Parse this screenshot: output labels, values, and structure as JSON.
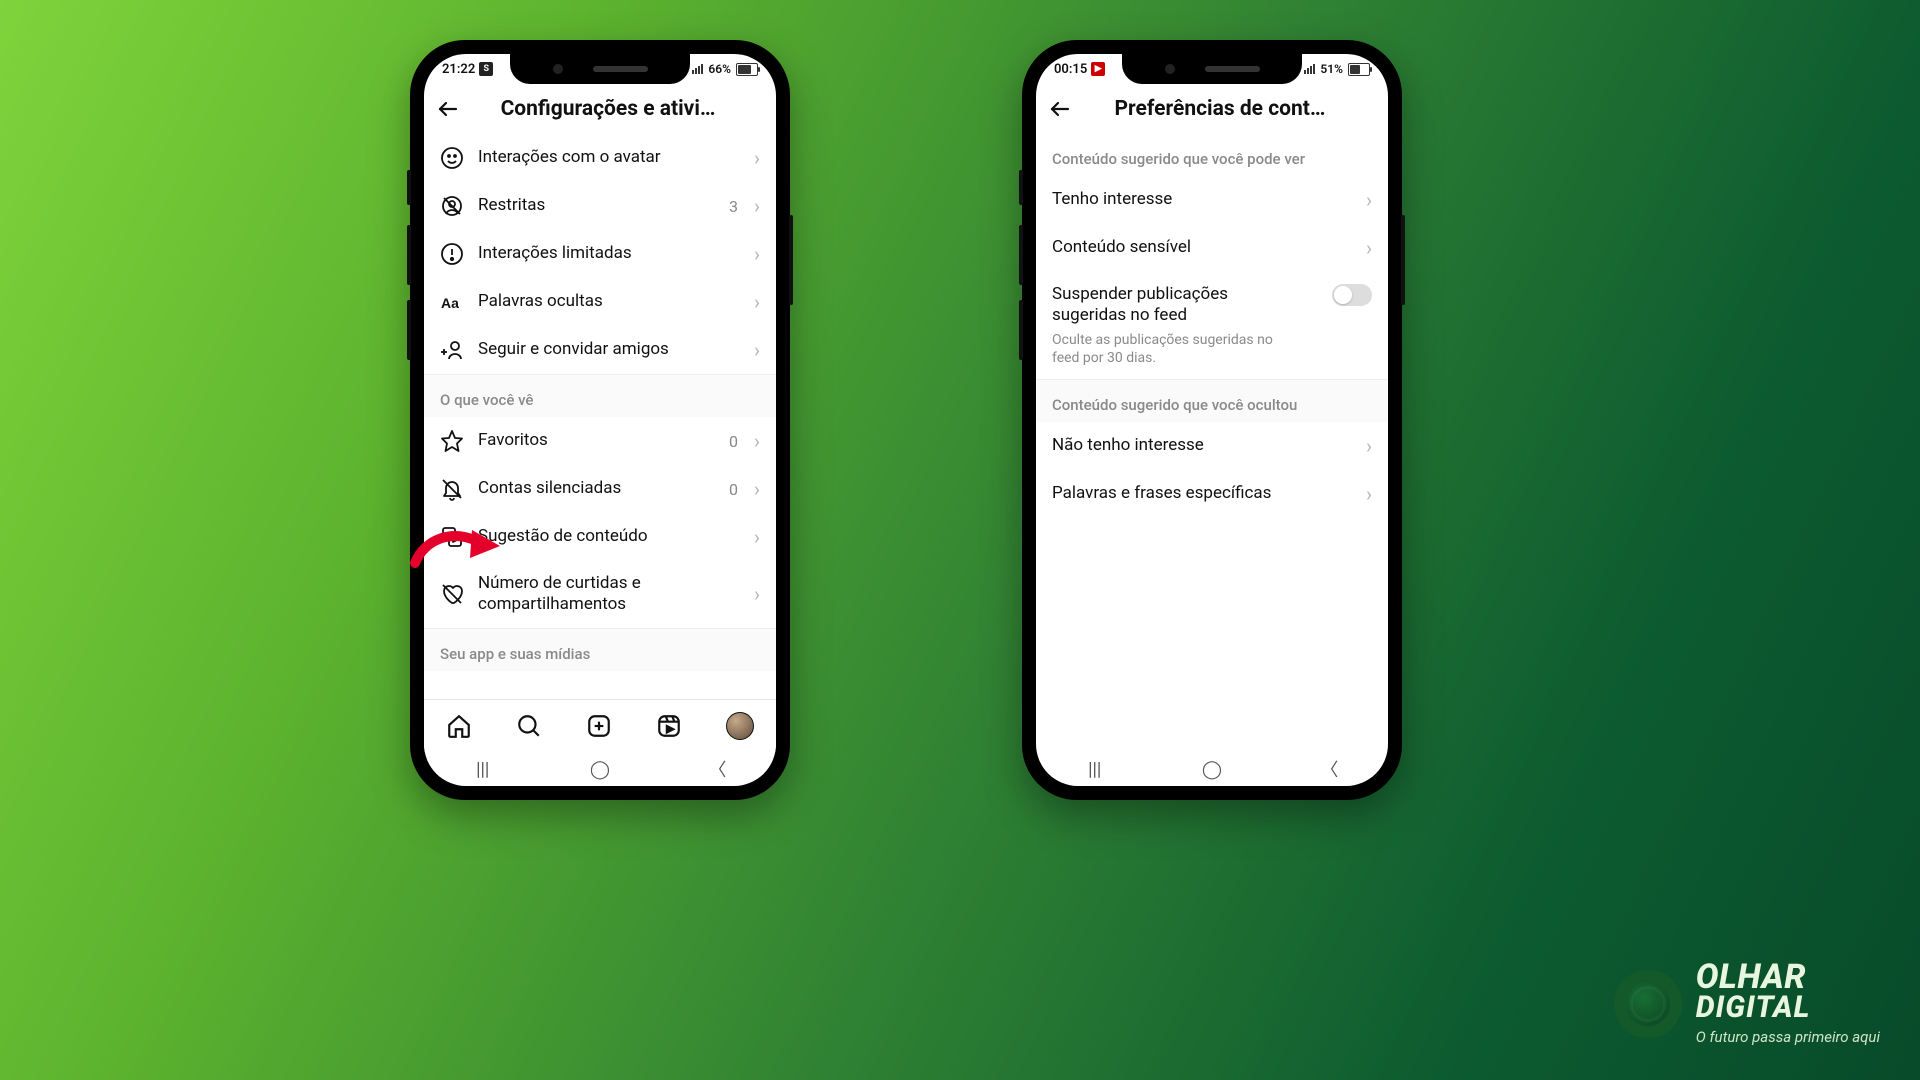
{
  "brand": {
    "line1": "OLHAR",
    "line2": "DIGITAL",
    "tagline": "O futuro passa primeiro aqui"
  },
  "phone1": {
    "status": {
      "time": "21:22",
      "badge": "S",
      "battery_pct": "66%",
      "battery_fill": 66
    },
    "header_title": "Configurações e ativi…",
    "sections": [
      {
        "items": [
          {
            "icon": "avatar-icon",
            "label": "Interações com o avatar"
          },
          {
            "icon": "blocked-icon",
            "label": "Restritas",
            "value": "3"
          },
          {
            "icon": "alert-icon",
            "label": "Interações limitadas"
          },
          {
            "icon": "aa-icon",
            "label": "Palavras ocultas"
          },
          {
            "icon": "add-user-icon",
            "label": "Seguir e convidar amigos"
          }
        ]
      },
      {
        "title": "O que você vê",
        "items": [
          {
            "icon": "star-icon",
            "label": "Favoritos",
            "value": "0"
          },
          {
            "icon": "bell-off-icon",
            "label": "Contas silenciadas",
            "value": "0"
          },
          {
            "icon": "content-icon",
            "label": "Sugestão de conteúdo",
            "highlight": true
          },
          {
            "icon": "heart-off-icon",
            "label": "Número de curtidas e compartilhamentos"
          }
        ]
      },
      {
        "title": "Seu app e suas mídias",
        "items": []
      }
    ]
  },
  "phone2": {
    "status": {
      "time": "00:15",
      "badge": "▶",
      "battery_pct": "51%",
      "battery_fill": 51
    },
    "header_title": "Preferências de cont…",
    "group1_title": "Conteúdo sugerido que você pode ver",
    "group1_items": [
      {
        "label": "Tenho interesse"
      },
      {
        "label": "Conteúdo sensível"
      }
    ],
    "toggle_item": {
      "label": "Suspender publicações sugeridas no feed",
      "subtitle": "Oculte as publicações sugeridas no feed por 30 dias.",
      "on": false
    },
    "group2_title": "Conteúdo sugerido que você ocultou",
    "group2_items": [
      {
        "label": "Não tenho interesse"
      },
      {
        "label": "Palavras e frases específicas"
      }
    ]
  }
}
